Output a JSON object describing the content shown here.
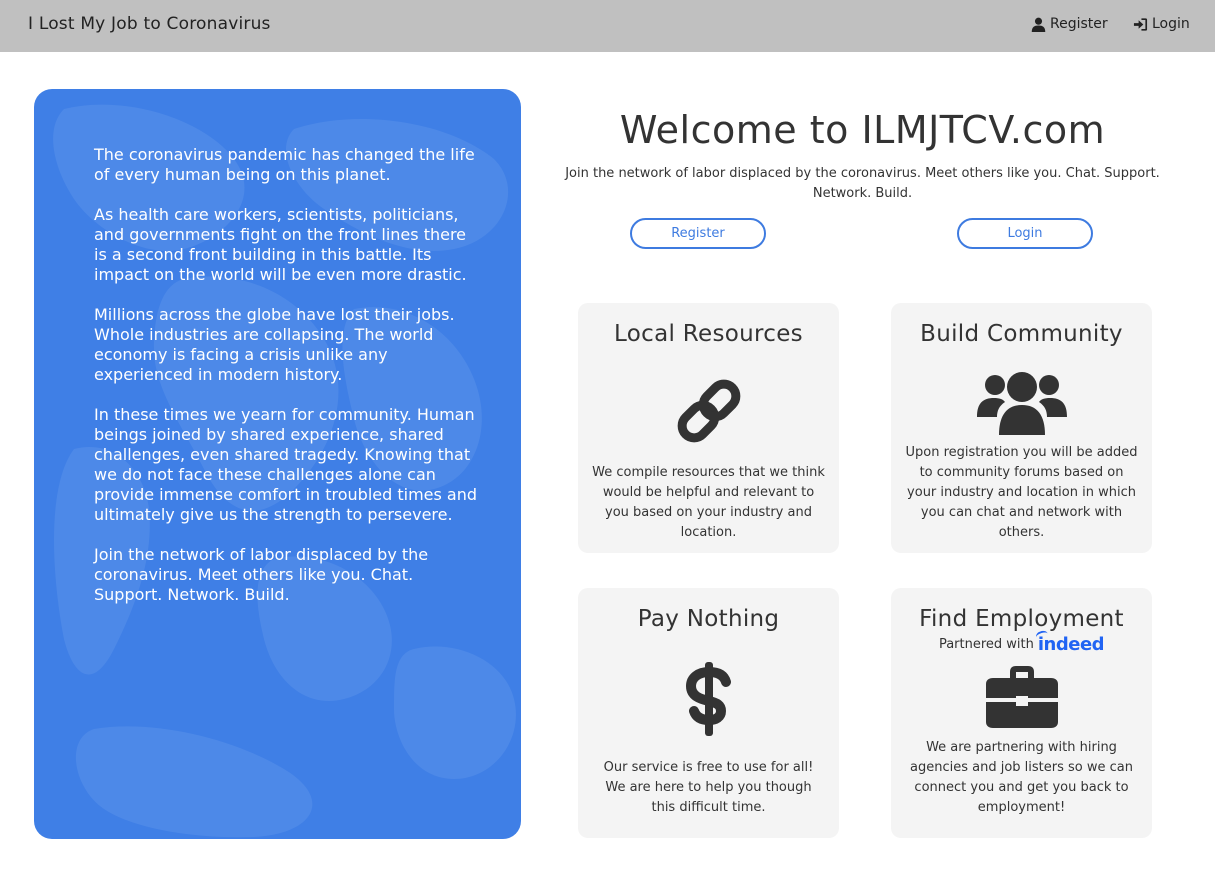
{
  "navbar": {
    "brand": "I Lost My Job to Coronavirus",
    "register_label": "Register",
    "login_label": "Login"
  },
  "hero": {
    "paragraphs": [
      "The coronavirus pandemic has changed the life of every human being on this planet.",
      "As health care workers, scientists, politicians, and governments fight on the front lines there is a second front building in this battle. Its impact on the world will be even more drastic.",
      "Millions across the globe have lost their jobs. Whole industries are collapsing. The world economy is facing a crisis unlike any experienced in modern history.",
      "In these times we yearn for community. Human beings joined by shared experience, shared challenges, even shared tragedy. Knowing that we do not face these challenges alone can provide immense comfort in troubled times and ultimately give us the strength to persevere.",
      "Join the network of labor displaced by the coronavirus. Meet others like you. Chat. Support. Network. Build."
    ]
  },
  "main": {
    "title": "Welcome to ILMJTCV.com",
    "subtitle": "Join the network of labor displaced by the coronavirus. Meet others like you. Chat. Support. Network. Build.",
    "register_button": "Register",
    "login_button": "Login"
  },
  "cards": [
    {
      "title": "Local Resources",
      "icon": "link-icon",
      "description": "We compile resources that we think would be helpful and relevant to you based on your industry and location."
    },
    {
      "title": "Build Community",
      "icon": "users-icon",
      "description": "Upon registration you will be added to community forums based on your industry and location in which you can chat and network with others."
    },
    {
      "title": "Pay Nothing",
      "icon": "dollar-icon",
      "description": "Our service is free to use for all! We are here to help you though this difficult time."
    },
    {
      "title": "Find Employment",
      "partner_text": "Partnered with",
      "partner_logo": "indeed",
      "icon": "briefcase-icon",
      "description": "We are partnering with hiring agencies and job listers so we can connect you and get you back to employment!"
    }
  ],
  "colors": {
    "navbar": "#c0c0c0",
    "hero": "#3f7fe6",
    "accent": "#3e7be0",
    "card": "#f4f4f4",
    "indeed": "#2164f3"
  }
}
